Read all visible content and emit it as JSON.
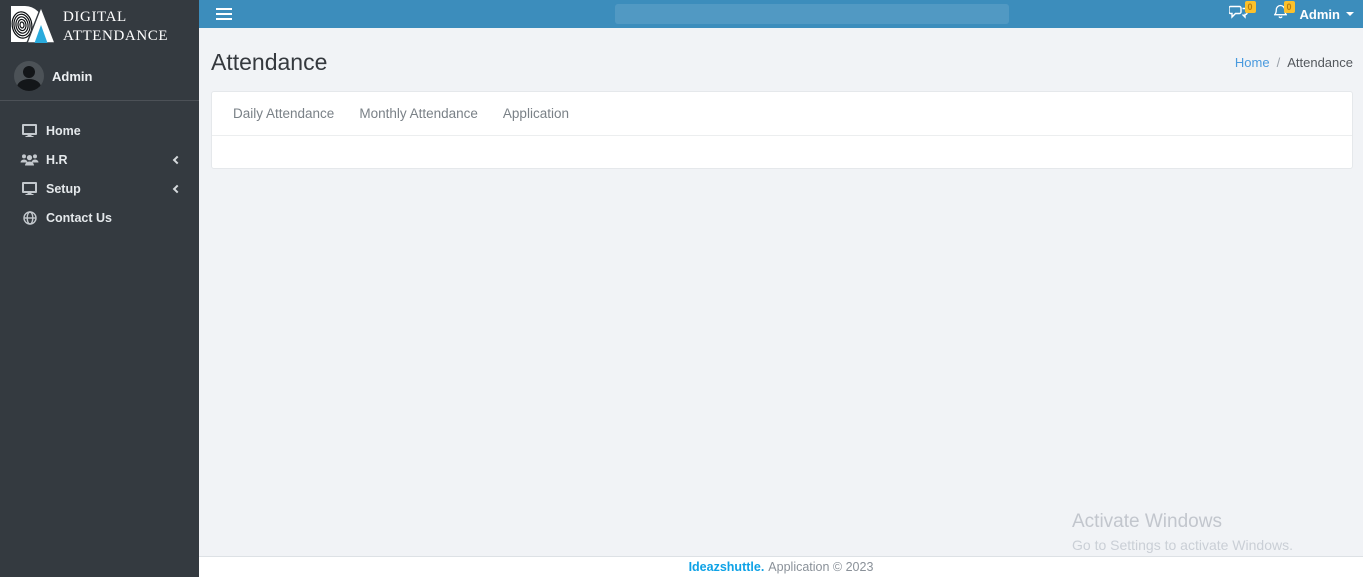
{
  "brand": {
    "name_line1": "DIGITAL",
    "name_line2": "ATTENDANCE"
  },
  "user_panel": {
    "name": "Admin"
  },
  "sidebar": {
    "items": [
      {
        "label": "Home",
        "icon": "monitor-icon",
        "expandable": false
      },
      {
        "label": "H.R",
        "icon": "users-icon",
        "expandable": true
      },
      {
        "label": "Setup",
        "icon": "monitor-icon",
        "expandable": true
      },
      {
        "label": "Contact Us",
        "icon": "globe-icon",
        "expandable": false
      }
    ]
  },
  "topbar": {
    "search": {
      "value": "",
      "placeholder": ""
    },
    "messages_badge": "0",
    "notifications_badge": "0",
    "user_menu_label": "Admin"
  },
  "page": {
    "title": "Attendance",
    "breadcrumb": {
      "home": "Home",
      "separator": "/",
      "current": "Attendance"
    }
  },
  "tabs": [
    {
      "label": "Daily Attendance"
    },
    {
      "label": "Monthly Attendance"
    },
    {
      "label": "Application"
    }
  ],
  "footer": {
    "brand": "Ideazshuttle.",
    "text": "Application © 2023"
  },
  "watermark": {
    "line1": "Activate Windows",
    "line2": "Go to Settings to activate Windows."
  },
  "colors": {
    "topbar": "#3c8dbc",
    "sidebar": "#343a40",
    "badge": "#fcc12c",
    "breadcrumb_link": "#4a9ade",
    "footer_brand": "#0ea2e6",
    "logo_triangle": "#29aadc"
  }
}
